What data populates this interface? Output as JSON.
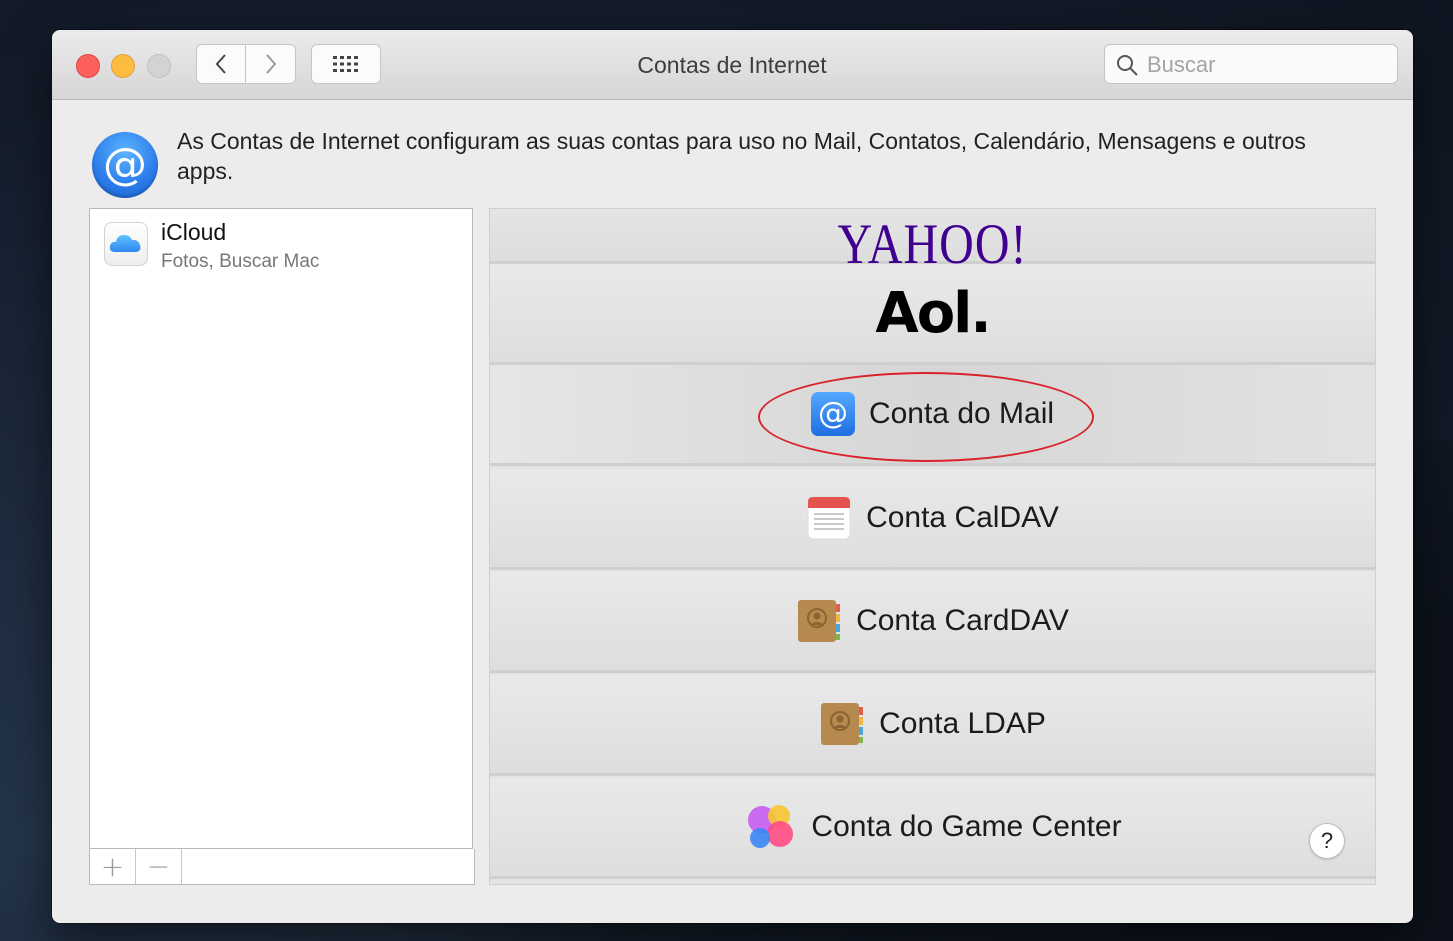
{
  "window": {
    "title": "Contas de Internet",
    "search_placeholder": "Buscar"
  },
  "header": {
    "description": "As Contas de Internet configuram as suas contas para uso no Mail, Contatos, Calendário, Mensagens e outros apps."
  },
  "accounts": [
    {
      "name": "iCloud",
      "services": "Fotos, Buscar Mac",
      "icon": "icloud-icon"
    }
  ],
  "list_toolbar": {
    "add_label": "+",
    "remove_label": "−"
  },
  "providers": {
    "yahoo": "YAHOO!",
    "aol": "Aol.",
    "mail": "Conta do Mail",
    "caldav": "Conta CalDAV",
    "carddav": "Conta CardDAV",
    "ldap": "Conta LDAP",
    "gamecenter": "Conta do Game Center",
    "highlighted": "Conta do Mail"
  },
  "help_label": "?",
  "colors": {
    "highlight_ellipse": "#d8232a",
    "yahoo_purple": "#400191",
    "mail_blue": "#1e6fe0"
  }
}
